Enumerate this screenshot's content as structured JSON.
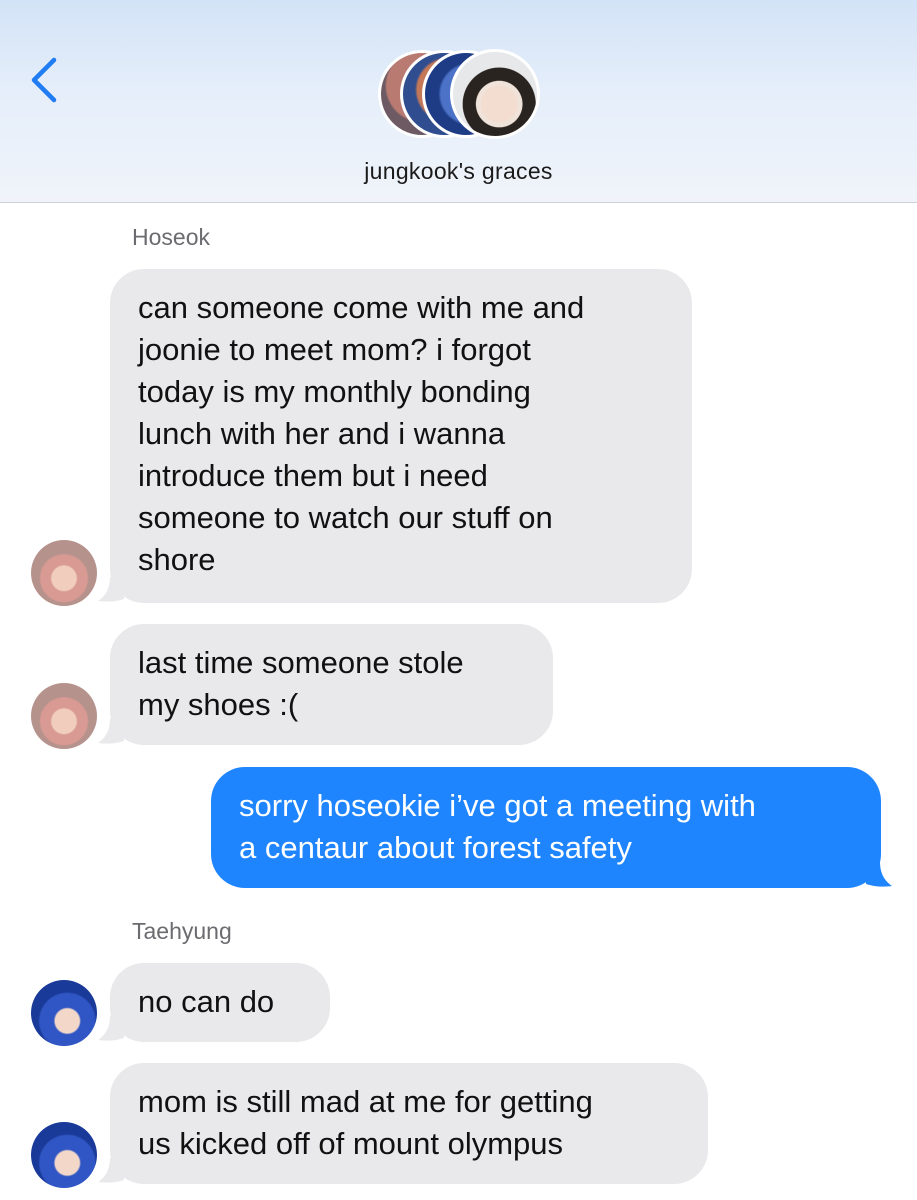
{
  "header": {
    "back_label": "",
    "group_name": "jungkook's graces",
    "group_avatars": [
      "avatar",
      "avatar",
      "avatar",
      "avatar"
    ]
  },
  "messages": [
    {
      "sender": "Hoseok",
      "direction": "incoming",
      "bubbles": [
        "can someone come with me and\njoonie to meet mom? i forgot\ntoday is my monthly bonding\nlunch with her and i wanna\nintroduce them but i need\nsomeone to watch our stuff on\nshore",
        "last time someone stole\nmy shoes :("
      ]
    },
    {
      "sender": "",
      "direction": "outgoing",
      "bubbles": [
        "sorry hoseokie i’ve got a meeting with\na centaur about forest safety"
      ]
    },
    {
      "sender": "Taehyung",
      "direction": "incoming",
      "bubbles": [
        "no can do",
        "mom is still mad at me for getting\nus kicked off of mount olympus"
      ]
    }
  ],
  "colors": {
    "outgoing_bubble": "#1f85ff",
    "incoming_bubble": "#e9e9eb",
    "accent": "#1f7cf2",
    "sender_label": "#6b6b70"
  }
}
